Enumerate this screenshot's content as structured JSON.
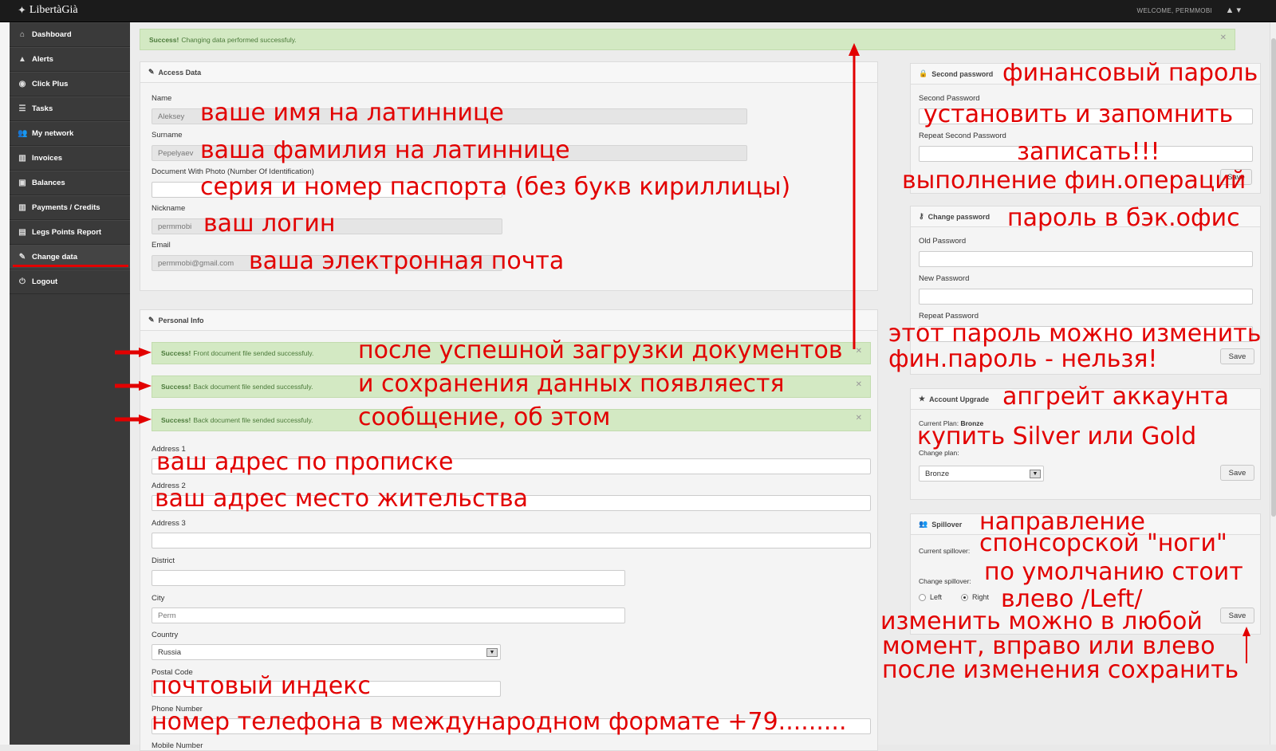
{
  "app": {
    "logo": "LibertàGià",
    "welcome": "WELCOME, PERMMOBI"
  },
  "sidebar": {
    "items": [
      {
        "label": "Dashboard",
        "icon": "home-icon",
        "glyph": "⌂"
      },
      {
        "label": "Alerts",
        "icon": "warning-icon",
        "glyph": "▲"
      },
      {
        "label": "Click Plus",
        "icon": "globe-icon",
        "glyph": "◉"
      },
      {
        "label": "Tasks",
        "icon": "list-icon",
        "glyph": "☰"
      },
      {
        "label": "My network",
        "icon": "users-icon",
        "glyph": "👥"
      },
      {
        "label": "Invoices",
        "icon": "bars-icon",
        "glyph": "▥"
      },
      {
        "label": "Balances",
        "icon": "money-icon",
        "glyph": "▣"
      },
      {
        "label": "Payments / Credits",
        "icon": "bars-icon",
        "glyph": "▥"
      },
      {
        "label": "Legs Points Report",
        "icon": "chart-icon",
        "glyph": "▤"
      },
      {
        "label": "Change data",
        "icon": "edit-icon",
        "glyph": "✎"
      },
      {
        "label": "Logout",
        "icon": "power-icon",
        "glyph": "⏻"
      }
    ]
  },
  "top_alert": {
    "strong": "Success!",
    "text": "Changing data performed successfuly."
  },
  "access": {
    "title": "Access Data",
    "name_label": "Name",
    "name_value": "Aleksey",
    "surname_label": "Surname",
    "surname_value": "Pepelyaev",
    "doc_label": "Document With Photo (Number Of Identification)",
    "doc_value": "",
    "nick_label": "Nickname",
    "nick_value": "permmobi",
    "email_label": "Email",
    "email_value": "permmobi@gmail.com"
  },
  "personal": {
    "title": "Personal Info",
    "alerts": [
      {
        "strong": "Success!",
        "text": "Front document file sended successfuly."
      },
      {
        "strong": "Success!",
        "text": "Back document file sended successfuly."
      },
      {
        "strong": "Success!",
        "text": "Back document file sended successfuly."
      }
    ],
    "address1_label": "Address 1",
    "address2_label": "Address 2",
    "address3_label": "Address 3",
    "district_label": "District",
    "city_label": "City",
    "city_value": "Perm",
    "country_label": "Country",
    "country_value": "Russia",
    "postal_label": "Postal Code",
    "phone_label": "Phone Number",
    "mobile_label": "Mobile Number"
  },
  "second_password": {
    "title": "Second password",
    "pw_label": "Second Password",
    "repeat_label": "Repeat Second Password",
    "save": "Save"
  },
  "change_password": {
    "title": "Change password",
    "old_label": "Old Password",
    "new_label": "New Password",
    "repeat_label": "Repeat Password",
    "save": "Save"
  },
  "upgrade": {
    "title": "Account Upgrade",
    "current_label": "Current Plan:",
    "current_value": "Bronze",
    "change_label": "Change plan:",
    "plan_value": "Bronze",
    "save": "Save"
  },
  "spillover": {
    "title": "Spillover",
    "current_label": "Current spillover:",
    "change_label": "Change spillover:",
    "left": "Left",
    "right": "Right",
    "save": "Save"
  },
  "annotations": {
    "name": "ваше имя на латиннице",
    "surname": "ваша фамилия на латиннице",
    "doc": "серия и номер паспорта (без букв кириллицы)",
    "login": "ваш логин",
    "email": "ваша электронная почта",
    "upload1": "после успешной загрузки документов",
    "upload2": "и сохранения данных появляестя",
    "upload3": "сообщение, об этом",
    "addr1": "ваш адрес по прописке",
    "addr2": "ваш адрес место жительства",
    "postal": "почтовый индекс",
    "phone": "номер телефона в международном формате +79.........",
    "fin_pw": "финансовый пароль",
    "set_remember": "установить и запомнить",
    "write_down": "записать!!!",
    "fin_ops": "выполнение фин.операций",
    "backoffice_pw": "пароль в бэк.офис",
    "can_change": "этот пароль можно изменить",
    "cannot_change": "фин.пароль - нельзя!",
    "upgrade": "апгрейт аккаунта",
    "buy": "купить Silver или Gold",
    "spill1": "направление",
    "spill2": "спонсорской \"ноги\"",
    "spill3": "по умолчанию стоит",
    "spill4": "влево /Left/",
    "spill5": "изменить можно в любой",
    "spill6": "момент, вправо или влево",
    "spill7": "после изменения сохранить"
  }
}
